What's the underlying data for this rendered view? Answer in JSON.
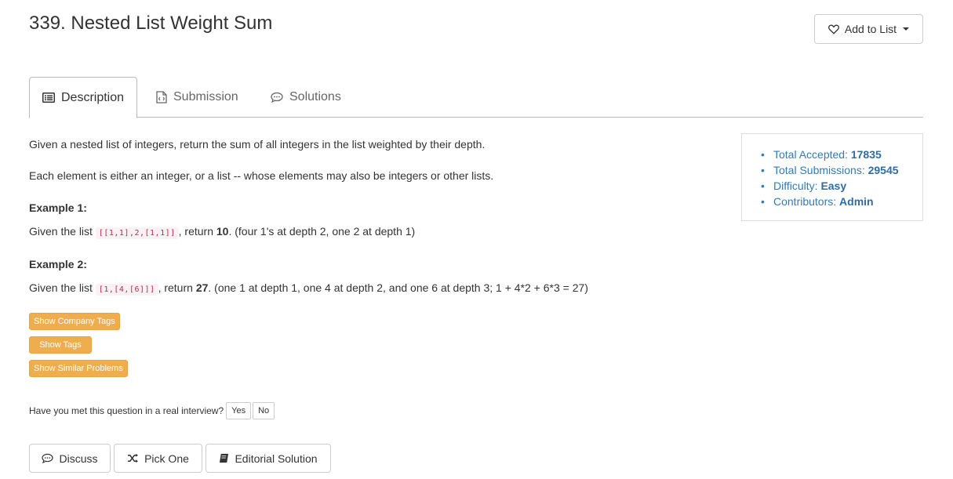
{
  "title": "339. Nested List Weight Sum",
  "add_to_list": "Add to List",
  "tabs": {
    "description": "Description",
    "submission": "Submission",
    "solutions": "Solutions"
  },
  "description": {
    "line1": "Given a nested list of integers, return the sum of all integers in the list weighted by their depth.",
    "line2": "Each element is either an integer, or a list -- whose elements may also be integers or other lists.",
    "example1_heading": "Example 1:",
    "example1": {
      "prefix": "Given the list ",
      "code": "[[1,1],2,[1,1]]",
      "mid": ", return ",
      "value": "10",
      "suffix": ". (four 1's at depth 2, one 2 at depth 1)"
    },
    "example2_heading": "Example 2:",
    "example2": {
      "prefix": "Given the list ",
      "code": "[1,[4,[6]]]",
      "mid": ", return ",
      "value": "27",
      "suffix": ". (one 1 at depth 1, one 4 at depth 2, and one 6 at depth 3; 1 + 4*2 + 6*3 = 27)"
    }
  },
  "buttons": {
    "company_tags": "Show Company Tags",
    "tags": "Show Tags",
    "similar": "Show Similar Problems"
  },
  "interview": {
    "question": "Have you met this question in a real interview?",
    "yes": "Yes",
    "no": "No"
  },
  "bottom": {
    "discuss": "Discuss",
    "pick_one": "Pick One",
    "editorial": "Editorial Solution"
  },
  "stats": {
    "accepted_label": "Total Accepted: ",
    "accepted": "17835",
    "submissions_label": "Total Submissions: ",
    "submissions": "29545",
    "difficulty_label": "Difficulty: ",
    "difficulty": "Easy",
    "contributors_label": "Contributors: ",
    "contributors": "Admin"
  },
  "icons": {
    "add": "heart-icon",
    "description": "list-icon",
    "submission": "code-file-icon",
    "solutions": "comment-icon",
    "discuss": "comment-icon",
    "pick_one": "shuffle-icon",
    "editorial": "book-icon"
  }
}
